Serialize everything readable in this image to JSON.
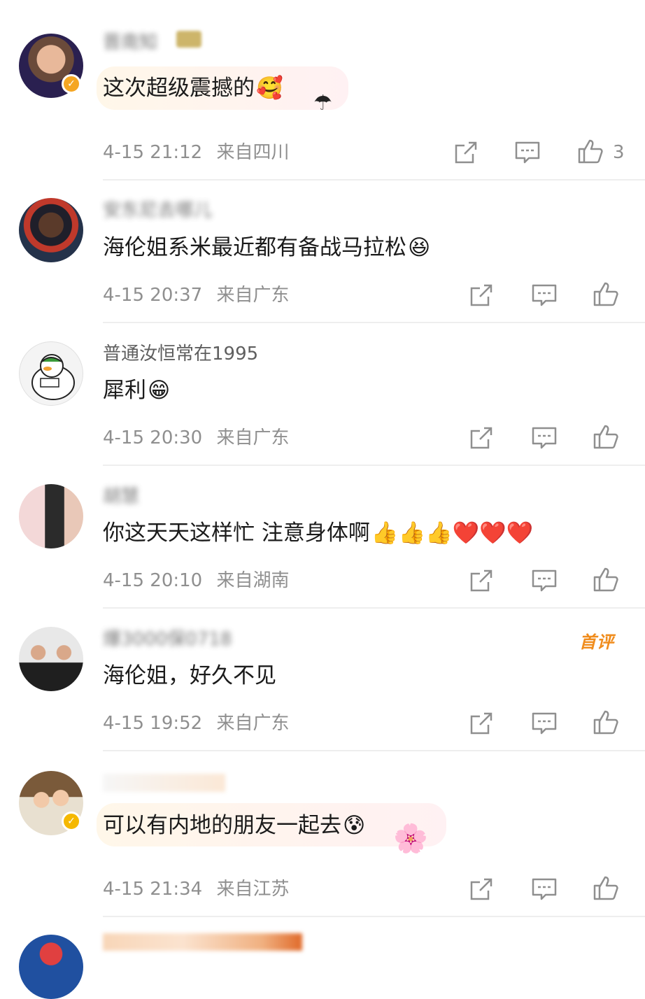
{
  "comments": [
    {
      "username": "晋南知",
      "text": "这次超级震撼的",
      "emoji": "🥰",
      "date": "4-15 21:12",
      "location": "来自四川",
      "likes": "3",
      "verified": true,
      "badge_color": "#f5a623"
    },
    {
      "username": "安东尼去哪儿",
      "text": "海伦姐系米最近都有备战马拉松",
      "emoji": "😆",
      "date": "4-15 20:37",
      "location": "来自广东",
      "likes": ""
    },
    {
      "username": "普通汝恒常在1995",
      "text": "犀利",
      "emoji": "😁",
      "date": "4-15 20:30",
      "location": "来自广东",
      "likes": ""
    },
    {
      "username": "胡慧",
      "text": "你这天天这样忙 注意身体啊",
      "emoji": "👍👍👍❤️❤️❤️",
      "date": "4-15 20:10",
      "location": "来自湖南",
      "likes": ""
    },
    {
      "username": "爆3000保0718",
      "text": "海伦姐，好久不见",
      "emoji": "",
      "date": "4-15 19:52",
      "location": "来自广东",
      "likes": "",
      "first_badge": "首评"
    },
    {
      "username": "",
      "text": "可以有内地的朋友一起去",
      "emoji": "😰",
      "date": "4-15 21:34",
      "location": "来自江苏",
      "likes": "",
      "verified": true,
      "badge_color": "#f5b800"
    }
  ],
  "icons": {
    "share": "share-icon",
    "reply": "comment-icon",
    "like": "thumbs-up-icon"
  },
  "colors": {
    "meta": "#8f8f8f",
    "text": "#1b1b1b",
    "first_badge": "#f08c1c"
  }
}
